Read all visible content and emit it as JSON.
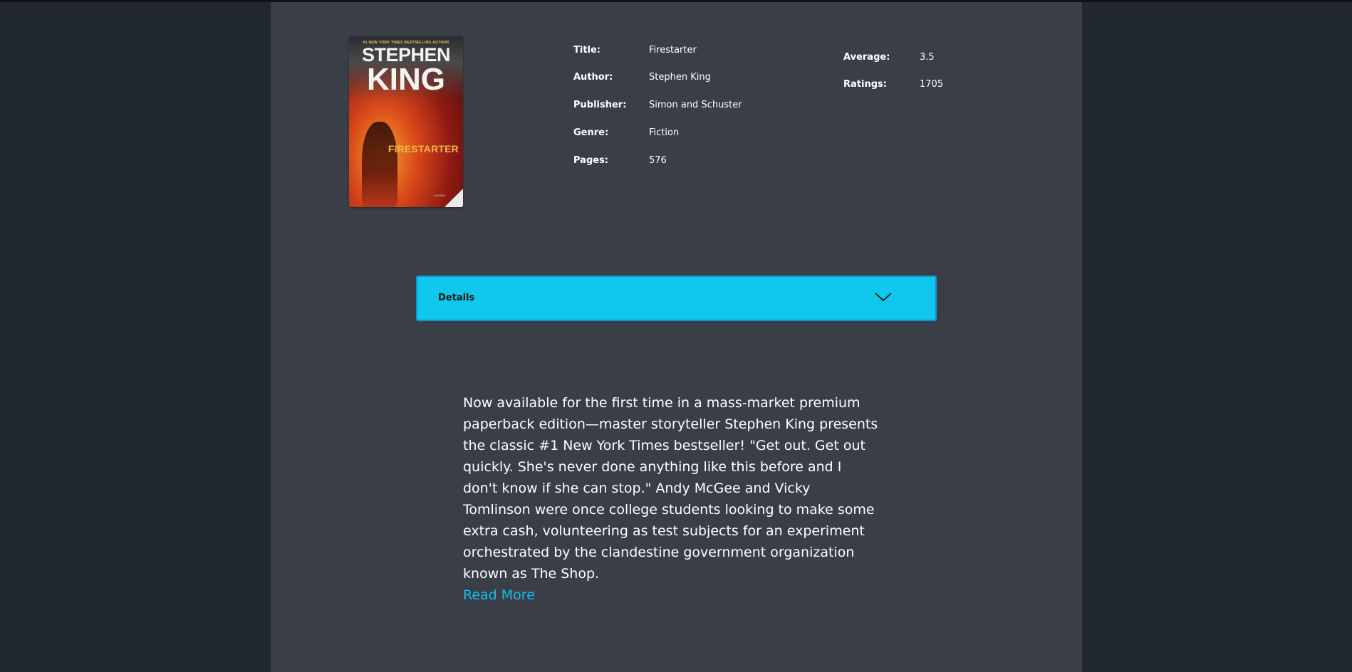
{
  "book": {
    "cover": {
      "tagline": "#1 NEW YORK TIMES BESTSELLING AUTHOR",
      "author_line1": "STEPHEN",
      "author_line2": "KING",
      "title": "FIRESTARTER",
      "subtitle": "A NOVEL"
    },
    "fields": [
      {
        "label": "Title:",
        "value": "Firestarter"
      },
      {
        "label": "Author:",
        "value": "Stephen King"
      },
      {
        "label": "Publisher:",
        "value": "Simon and Schuster"
      },
      {
        "label": "Genre:",
        "value": "Fiction"
      },
      {
        "label": "Pages:",
        "value": "576"
      }
    ],
    "ratings": [
      {
        "label": "Average:",
        "value": "3.5"
      },
      {
        "label": "Ratings:",
        "value": "1705"
      }
    ]
  },
  "details": {
    "label": "Details",
    "icon": "chevron-down-icon"
  },
  "description": {
    "text": "Now available for the first time in a mass-market premium paperback edition—master storyteller Stephen King presents the classic #1 New York Times bestseller! \"Get out. Get out quickly. She's never done anything like this before and I don't know if she can stop.\" Andy McGee and Vicky Tomlinson were once college students looking to make some extra cash, volunteering as test subjects for an experiment orchestrated by the clandestine government organization known as The Shop.",
    "read_more": "Read More"
  },
  "colors": {
    "page_bg": "#222831",
    "panel_bg": "#393e47",
    "accent": "#10c8ee",
    "link": "#10c0ec"
  }
}
